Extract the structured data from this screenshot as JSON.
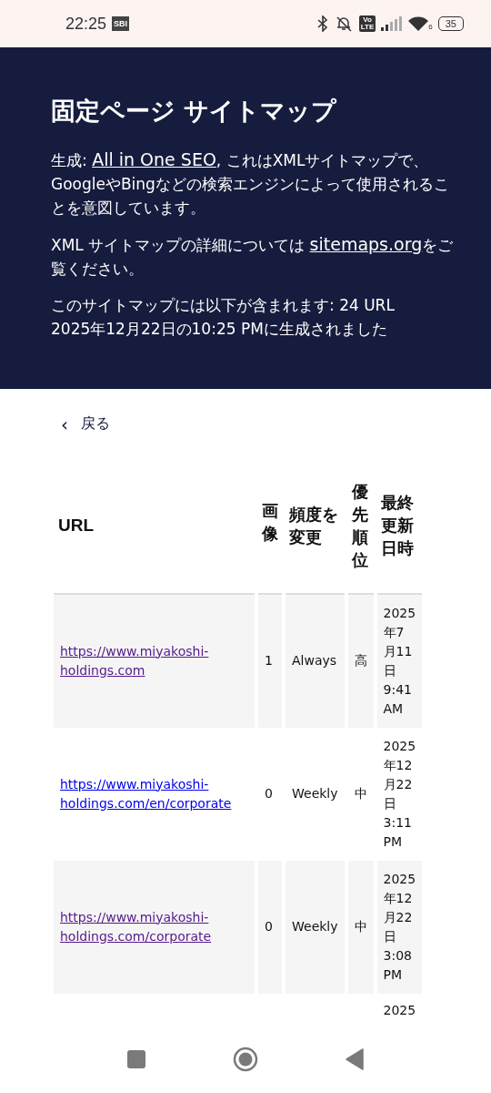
{
  "status_bar": {
    "time": "22:25",
    "carrier_badge": "SBI",
    "volte_top": "Vo",
    "volte_bottom": "LTE",
    "wifi_label": "6",
    "battery": "35"
  },
  "header": {
    "title": "固定ページ サイトマップ",
    "intro": {
      "prefix": "生成: ",
      "link": "All in One SEO",
      "suffix": ", これはXMLサイトマップで、GoogleやBingなどの検索エンジンによって使用されることを意図しています。"
    },
    "info": {
      "prefix": "XML サイトマップの詳細については ",
      "link": "sitemaps.org",
      "suffix": "をご覧ください。"
    },
    "summary": [
      "このサイトマップには以下が含まれます: 24 URL",
      "2025年12月22日の10:25 PMに生成されました"
    ]
  },
  "back_link": {
    "icon": "‹",
    "label": "戻る"
  },
  "table": {
    "columns": [
      "URL",
      "画像",
      "頻度を変更",
      "優先順位",
      "最終更新日時"
    ],
    "rows": [
      {
        "url": "https://www.miyakoshi-holdings.com",
        "visited": true,
        "images": "1",
        "frequency": "Always",
        "priority": "高",
        "last_modified": "2025年7月11日 9:41 AM"
      },
      {
        "url": "https://www.miyakoshi-holdings.com/en/corporate",
        "visited": false,
        "images": "0",
        "frequency": "Weekly",
        "priority": "中",
        "last_modified": "2025年12月22日 3:11 PM"
      },
      {
        "url": "https://www.miyakoshi-holdings.com/corporate",
        "visited": true,
        "images": "0",
        "frequency": "Weekly",
        "priority": "中",
        "last_modified": "2025年12月22日 3:08 PM"
      },
      {
        "last_modified": "2025"
      }
    ]
  }
}
